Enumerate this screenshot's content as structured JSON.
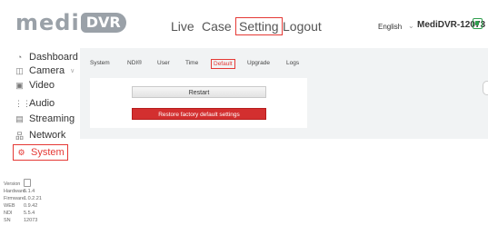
{
  "logo": {
    "medi": "medi",
    "dvr": "DVR"
  },
  "nav": {
    "live": "Live",
    "case": "Case",
    "setting": "Setting",
    "logout": "Logout"
  },
  "header": {
    "language": "English",
    "device_name": "MediDVR-12073"
  },
  "sidebar": {
    "items": [
      {
        "label": "Dashboard",
        "icon": "dashboard-icon"
      },
      {
        "label": "Camera",
        "icon": "camera-icon"
      },
      {
        "label": "Video",
        "icon": "video-icon"
      },
      {
        "label": "Audio",
        "icon": "audio-icon"
      },
      {
        "label": "Streaming",
        "icon": "streaming-icon"
      },
      {
        "label": "Network",
        "icon": "network-icon"
      },
      {
        "label": "System",
        "icon": "system-icon"
      }
    ]
  },
  "version": {
    "label": "Version",
    "rows": [
      {
        "key": "Hardware",
        "value": "5.1.4"
      },
      {
        "key": "Firmware",
        "value": "1.0.2.21"
      },
      {
        "key": "WEB",
        "value": "0.9.42"
      },
      {
        "key": "NDI",
        "value": "5.5.4"
      },
      {
        "key": "SN",
        "value": "12073"
      }
    ]
  },
  "tabs": [
    "System",
    "NDI®",
    "User",
    "Time",
    "Default",
    "Upgrade",
    "Logs"
  ],
  "active_tab": "Default",
  "buttons": {
    "restart": "Restart",
    "restore": "Restore factory default settings"
  },
  "colors": {
    "accent_red": "#e53935",
    "restore_button": "#d32f2f",
    "logo_gray": "#9aa1a8",
    "status_green": "#2e9e4d"
  }
}
